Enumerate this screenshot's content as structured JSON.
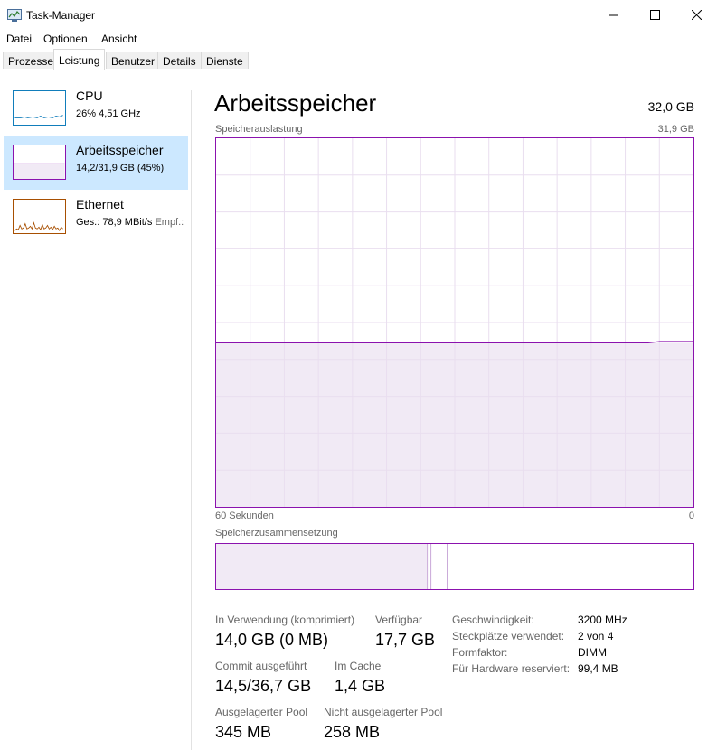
{
  "window": {
    "title": "Task-Manager"
  },
  "menu": [
    "Datei",
    "Optionen",
    "Ansicht"
  ],
  "tabs": [
    "Prozesse",
    "Leistung",
    "Benutzer",
    "Details",
    "Dienste"
  ],
  "colors": {
    "memory": "#8b12ae",
    "cpu": "#117dbb",
    "ethernet": "#a74f01",
    "selected": "#cce8ff"
  },
  "sidebar": {
    "cpu": {
      "title": "CPU",
      "sub": "26%  4,51 GHz"
    },
    "memory": {
      "title": "Arbeitsspeicher",
      "sub": "14,2/31,9 GB (45%)",
      "usage_fraction": 0.45
    },
    "ethernet": {
      "title": "Ethernet",
      "sub_label": "Ges.: 78,9 MBit/s",
      "sub_extra": "Empf.:"
    }
  },
  "main": {
    "title": "Arbeitsspeicher",
    "total": "32,0 GB",
    "usage_label": "Speicherauslastung",
    "usage_max": "31,9 GB",
    "time_left": "60 Sekunden",
    "time_right": "0",
    "composition_label": "Speicherzusammensetzung",
    "usage_fraction": 0.445
  },
  "stats": {
    "in_use_label": "In Verwendung (komprimiert)",
    "in_use_value": "14,0 GB (0 MB)",
    "available_label": "Verfügbar",
    "available_value": "17,7 GB",
    "commit_label": "Commit ausgeführt",
    "commit_value": "14,5/36,7 GB",
    "cache_label": "Im Cache",
    "cache_value": "1,4 GB",
    "paged_label": "Ausgelagerter Pool",
    "paged_value": "345 MB",
    "nonpaged_label": "Nicht ausgelagerter Pool",
    "nonpaged_value": "258 MB"
  },
  "details": [
    {
      "key": "Geschwindigkeit:",
      "value": "3200 MHz"
    },
    {
      "key": "Steckplätze verwendet:",
      "value": "2 von 4"
    },
    {
      "key": "Formfaktor:",
      "value": "DIMM"
    },
    {
      "key": "Für Hardware reserviert:",
      "value": "99,4 MB"
    }
  ]
}
